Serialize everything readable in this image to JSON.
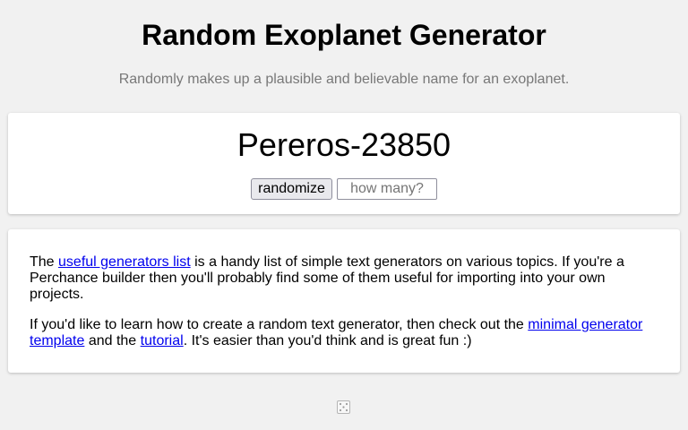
{
  "header": {
    "title": "Random Exoplanet Generator",
    "subtitle": "Randomly makes up a plausible and believable name for an exoplanet."
  },
  "generator": {
    "output": "Pereros-23850",
    "randomize_label": "randomize",
    "count_placeholder": "how many?"
  },
  "info": {
    "p1_prefix": "The ",
    "p1_link": "useful generators list",
    "p1_suffix": " is a handy list of simple text generators on various topics. If you're a Perchance builder then you'll probably find some of them useful for importing into your own projects.",
    "p2_prefix": "If you'd like to learn how to create a random text generator, then check out the ",
    "p2_link1": "minimal generator template",
    "p2_middle": " and the ",
    "p2_link2": "tutorial",
    "p2_suffix": ". It's easier than you'd think and is great fun :)"
  },
  "footer": {
    "icon": "dice-icon"
  }
}
